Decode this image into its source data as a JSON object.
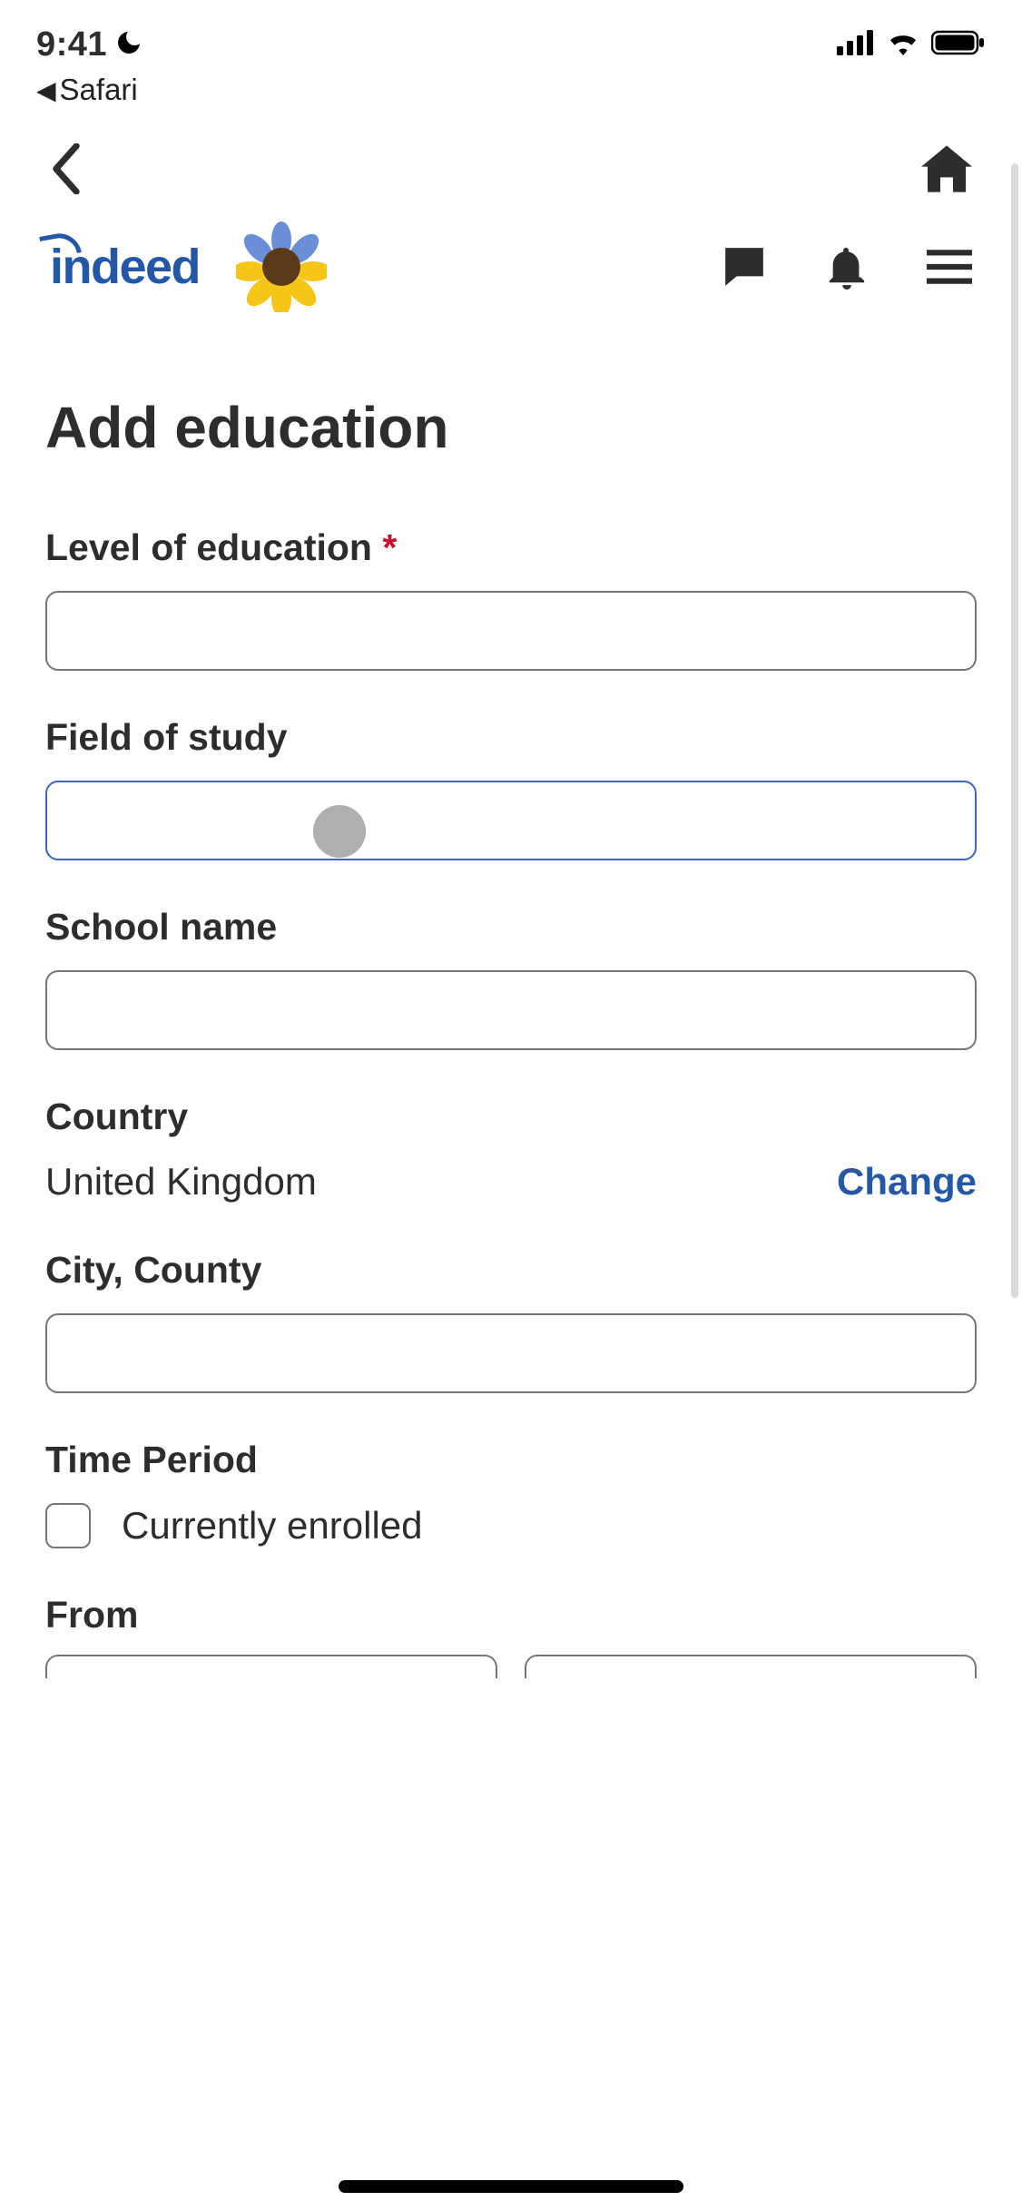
{
  "status": {
    "time": "9:41",
    "back_app": "Safari"
  },
  "brand": {
    "logo_text": "indeed"
  },
  "page": {
    "title": "Add education"
  },
  "fields": {
    "level": {
      "label": "Level of education",
      "required_mark": "*",
      "value": ""
    },
    "field_of_study": {
      "label": "Field of study",
      "value": ""
    },
    "school": {
      "label": "School name",
      "value": ""
    },
    "country": {
      "label": "Country",
      "value": "United Kingdom",
      "change_label": "Change"
    },
    "city": {
      "label": "City, County",
      "value": ""
    },
    "time_period": {
      "label": "Time Period",
      "checkbox_label": "Currently enrolled",
      "checked": false
    },
    "from": {
      "label": "From"
    }
  }
}
